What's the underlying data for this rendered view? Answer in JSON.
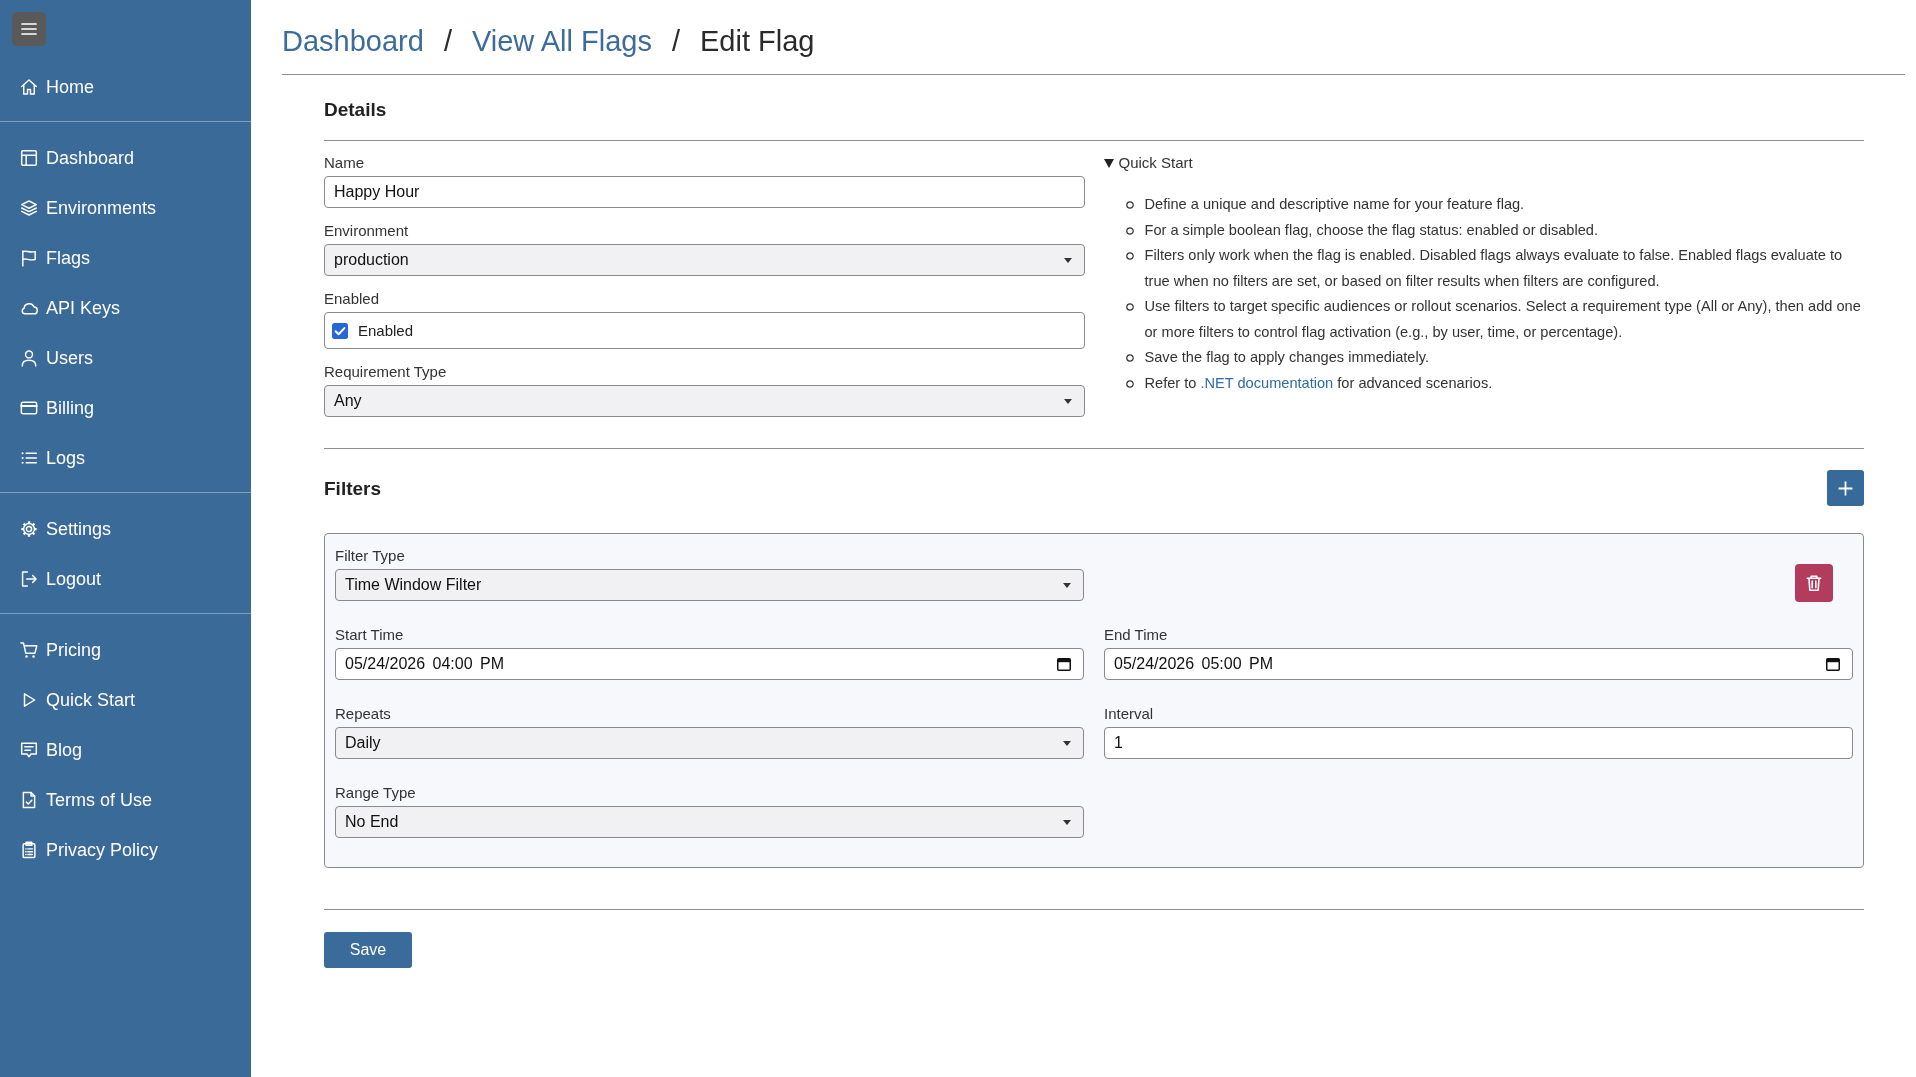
{
  "sidebar": {
    "sections": [
      {
        "items": [
          {
            "label": "Home"
          }
        ]
      },
      {
        "items": [
          {
            "label": "Dashboard"
          },
          {
            "label": "Environments"
          },
          {
            "label": "Flags"
          },
          {
            "label": "API Keys"
          },
          {
            "label": "Users"
          },
          {
            "label": "Billing"
          },
          {
            "label": "Logs"
          }
        ]
      },
      {
        "items": [
          {
            "label": "Settings"
          },
          {
            "label": "Logout"
          }
        ]
      },
      {
        "items": [
          {
            "label": "Pricing"
          },
          {
            "label": "Quick Start"
          },
          {
            "label": "Blog"
          },
          {
            "label": "Terms of Use"
          },
          {
            "label": "Privacy Policy"
          }
        ]
      }
    ]
  },
  "breadcrumb": [
    {
      "kind": "link",
      "label": "Dashboard"
    },
    {
      "kind": "separator",
      "label": "/"
    },
    {
      "kind": "link",
      "label": "View All Flags"
    },
    {
      "kind": "separator",
      "label": "/"
    },
    {
      "kind": "current",
      "label": "Edit Flag"
    }
  ],
  "details": {
    "title": "Details",
    "fields": [
      {
        "kind": "text",
        "label": "Name",
        "value": "Happy Hour"
      },
      {
        "kind": "select",
        "label": "Environment",
        "value": "production"
      },
      {
        "kind": "checkbox",
        "label": "Enabled",
        "option": "Enabled",
        "checked": true
      },
      {
        "kind": "select",
        "label": "Requirement Type",
        "value": "Any"
      }
    ]
  },
  "quick_start": {
    "title": "Quick Start",
    "expanded": true,
    "items": [
      {
        "text": "Define a unique and descriptive name for your feature flag."
      },
      {
        "text": "For a simple boolean flag, choose the flag status: enabled or disabled."
      },
      {
        "text": "Filters only work when the flag is enabled. Disabled flags always evaluate to false. Enabled flags evaluate to true when no filters are set, or based on filter results when filters are configured."
      },
      {
        "text": "Use filters to target specific audiences or rollout scenarios. Select a requirement type (All or Any), then add one or more filters to control flag activation (e.g., by user, time, or percentage)."
      },
      {
        "text": "Save the flag to apply changes immediately."
      },
      {
        "text": "Refer to ",
        "link": ".NET documentation",
        "after": " for advanced scenarios."
      }
    ]
  },
  "filters": {
    "title": "Filters",
    "items": [
      {
        "fields": [
          {
            "kind": "select",
            "label": "Filter Type",
            "value": "Time Window Filter"
          },
          {
            "kind": "datetime",
            "label": "Start Time",
            "value": "05/24/2026 04:00 PM"
          },
          {
            "kind": "datetime",
            "label": "End Time",
            "value": "05/24/2026 05:00 PM"
          },
          {
            "kind": "select",
            "label": "Repeats",
            "value": "Daily"
          },
          {
            "kind": "text",
            "label": "Interval",
            "value": "1"
          },
          {
            "kind": "select",
            "label": "Range Type",
            "value": "No End"
          }
        ]
      }
    ]
  },
  "save_button": {
    "label": "Save"
  }
}
